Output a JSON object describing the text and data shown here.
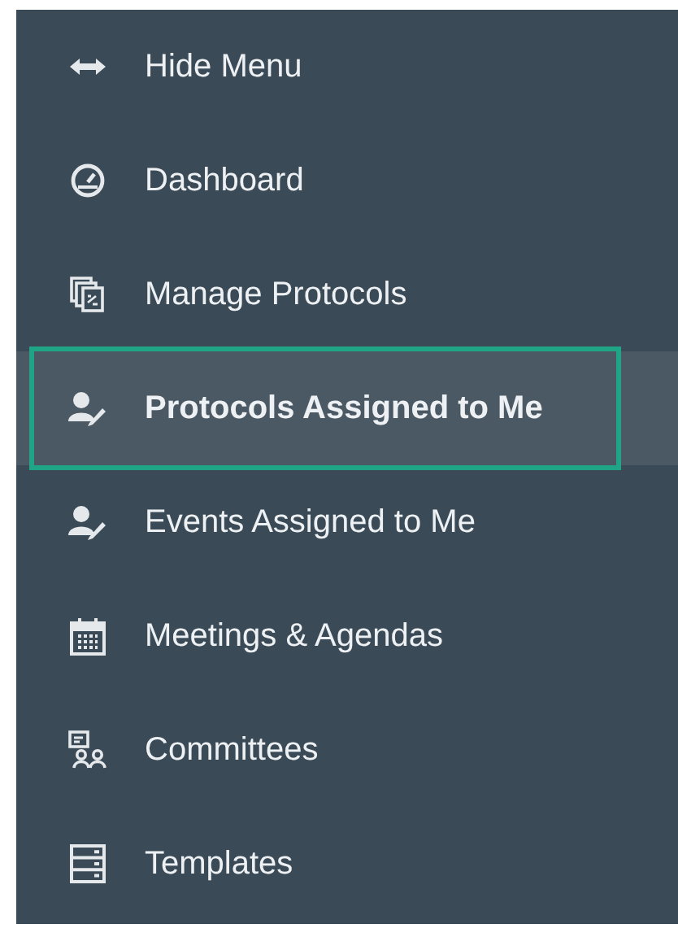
{
  "sidebar": {
    "items": [
      {
        "label": "Hide Menu",
        "selected": false
      },
      {
        "label": "Dashboard",
        "selected": false
      },
      {
        "label": "Manage Protocols",
        "selected": false
      },
      {
        "label": "Protocols Assigned to Me",
        "selected": true
      },
      {
        "label": "Events Assigned to Me",
        "selected": false
      },
      {
        "label": "Meetings & Agendas",
        "selected": false
      },
      {
        "label": "Committees",
        "selected": false
      },
      {
        "label": "Templates",
        "selected": false
      }
    ]
  }
}
